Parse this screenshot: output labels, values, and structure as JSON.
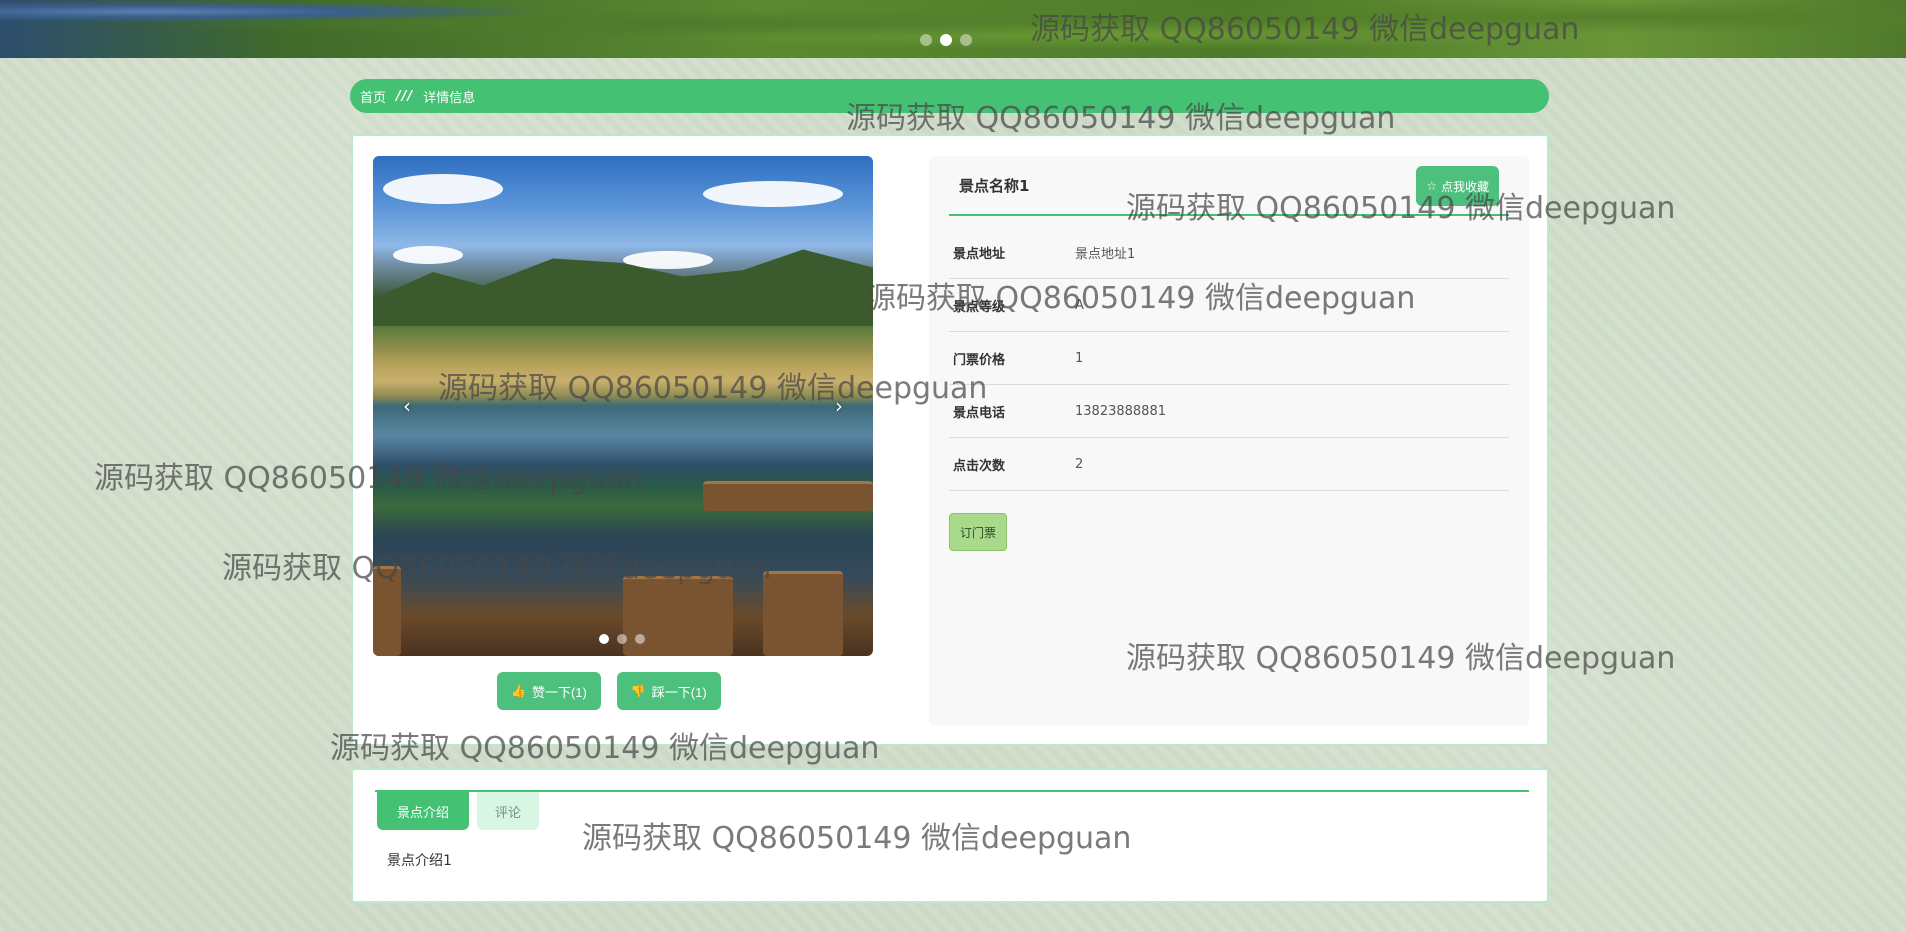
{
  "banner": {
    "dots": [
      false,
      true,
      false
    ]
  },
  "breadcrumb": {
    "home": "首页",
    "separator": "///",
    "current": "详情信息"
  },
  "gallery": {
    "prev_arrow": "‹",
    "next_arrow": "›",
    "dots": [
      true,
      false,
      false
    ]
  },
  "votes": {
    "like_label": "赞一下(1)",
    "dislike_label": "踩一下(1)"
  },
  "detail": {
    "title": "景点名称1",
    "favorite_label": "点我收藏",
    "fields": [
      {
        "label": "景点地址",
        "value": "景点地址1"
      },
      {
        "label": "景点等级",
        "value": "A"
      },
      {
        "label": "门票价格",
        "value": "1"
      },
      {
        "label": "景点电话",
        "value": "13823888881"
      },
      {
        "label": "点击次数",
        "value": "2"
      }
    ],
    "ticket_button": "订门票"
  },
  "tabs": [
    {
      "label": "景点介绍",
      "active": true
    },
    {
      "label": "评论",
      "active": false
    }
  ],
  "intro_text": "景点介绍1",
  "watermark": "源码获取 QQ86050149 微信deepguan",
  "colors": {
    "primary": "#45c174",
    "button": "#4ec07e",
    "ticket": "#a9d98a",
    "page_bg": "#cfdcc8"
  }
}
